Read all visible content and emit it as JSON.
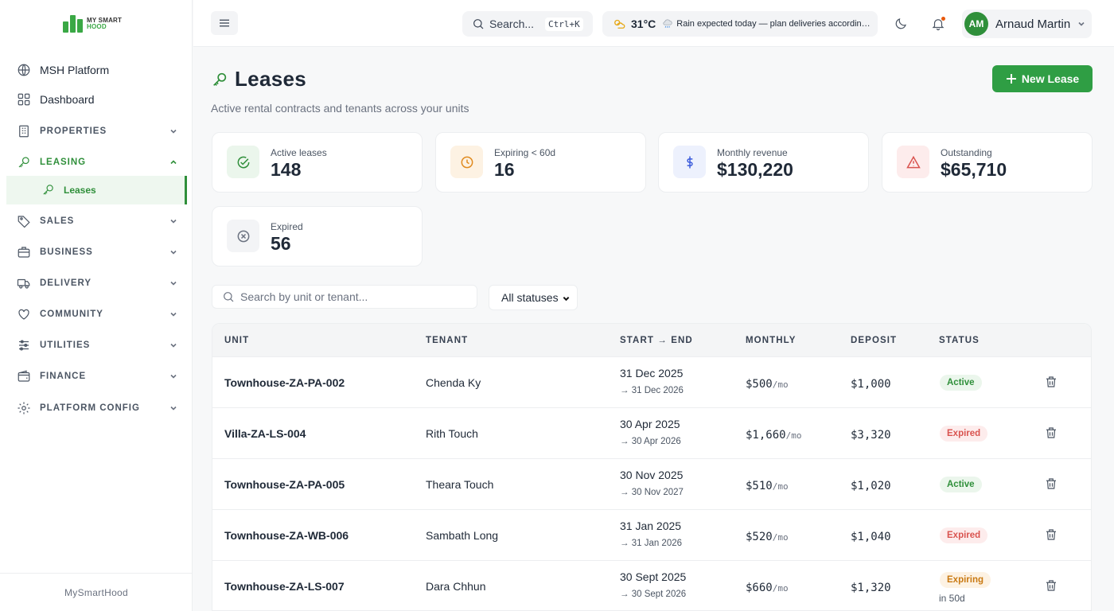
{
  "brand": {
    "line1": "MY SMART",
    "line2": "HOOD",
    "footer": "MySmartHood",
    "accent": "#2f9e44"
  },
  "sidebar": {
    "items": [
      {
        "label": "MSH Platform",
        "icon": "globe-icon"
      },
      {
        "label": "Dashboard",
        "icon": "grid-icon"
      },
      {
        "label": "PROPERTIES",
        "icon": "building-icon"
      },
      {
        "label": "LEASING",
        "icon": "key-icon"
      },
      {
        "label": "Leases",
        "icon": "key-icon"
      },
      {
        "label": "SALES",
        "icon": "tag-icon"
      },
      {
        "label": "BUSINESS",
        "icon": "briefcase-icon"
      },
      {
        "label": "DELIVERY",
        "icon": "truck-icon"
      },
      {
        "label": "COMMUNITY",
        "icon": "heart-icon"
      },
      {
        "label": "UTILITIES",
        "icon": "sliders-icon"
      },
      {
        "label": "FINANCE",
        "icon": "wallet-icon"
      },
      {
        "label": "PLATFORM CONFIG",
        "icon": "gear-icon"
      }
    ]
  },
  "topbar": {
    "search_label": "Search...",
    "shortcut": "Ctrl+K",
    "temperature": "31°C",
    "weather_message": "Rain expected today — plan deliveries accordingly",
    "user_initials": "AM",
    "user_name": "Arnaud Martin"
  },
  "page": {
    "title": "Leases",
    "subtitle": "Active rental contracts and tenants across your units",
    "new_button": "New Lease"
  },
  "stats": [
    {
      "label": "Active leases",
      "value": "148",
      "icon": "check-circle-icon",
      "color": "#2f8f3a"
    },
    {
      "label": "Expiring < 60d",
      "value": "16",
      "icon": "clock-icon",
      "color": "#e08a1e"
    },
    {
      "label": "Monthly revenue",
      "value": "$130,220",
      "icon": "dollar-icon",
      "color": "#3b5bdb"
    },
    {
      "label": "Outstanding",
      "value": "$65,710",
      "icon": "warning-icon",
      "color": "#d9534f"
    },
    {
      "label": "Expired",
      "value": "56",
      "icon": "x-circle-icon",
      "color": "#6b7280"
    }
  ],
  "filters": {
    "search_placeholder": "Search by unit or tenant...",
    "status_selected": "All statuses"
  },
  "table": {
    "headers": {
      "unit": "UNIT",
      "tenant": "TENANT",
      "start": "START",
      "end": "END",
      "monthly": "MONTHLY",
      "deposit": "DEPOSIT",
      "status": "STATUS"
    },
    "per_month": "/mo",
    "arrow": "→",
    "rows": [
      {
        "unit": "Townhouse-ZA-PA-002",
        "tenant": "Chenda Ky",
        "start": "31 Dec 2025",
        "end": "31 Dec 2026",
        "monthly": "$500",
        "deposit": "$1,000",
        "status": "Active",
        "status_sub": ""
      },
      {
        "unit": "Villa-ZA-LS-004",
        "tenant": "Rith Touch",
        "start": "30 Apr 2025",
        "end": "30 Apr 2026",
        "monthly": "$1,660",
        "deposit": "$3,320",
        "status": "Expired",
        "status_sub": ""
      },
      {
        "unit": "Townhouse-ZA-PA-005",
        "tenant": "Theara Touch",
        "start": "30 Nov 2025",
        "end": "30 Nov 2027",
        "monthly": "$510",
        "deposit": "$1,020",
        "status": "Active",
        "status_sub": ""
      },
      {
        "unit": "Townhouse-ZA-WB-006",
        "tenant": "Sambath Long",
        "start": "31 Jan 2025",
        "end": "31 Jan 2026",
        "monthly": "$520",
        "deposit": "$1,040",
        "status": "Expired",
        "status_sub": ""
      },
      {
        "unit": "Townhouse-ZA-LS-007",
        "tenant": "Dara Chhun",
        "start": "30 Sept 2025",
        "end": "30 Sept 2026",
        "monthly": "$660",
        "deposit": "$1,320",
        "status": "Expiring",
        "status_sub": "in 50d"
      }
    ]
  }
}
